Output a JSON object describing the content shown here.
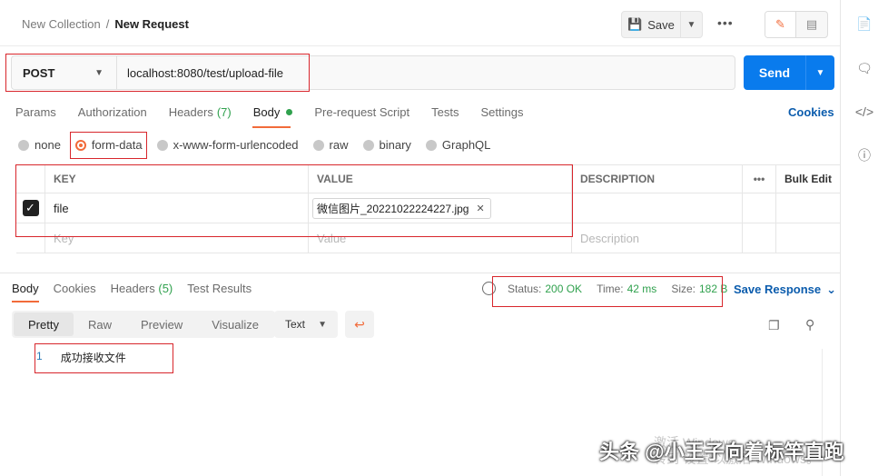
{
  "breadcrumb": {
    "parent": "New Collection",
    "separator": "/",
    "current": "New Request"
  },
  "toolbar": {
    "save_label": "Save",
    "more_label": "•••"
  },
  "request": {
    "method": "POST",
    "url": "localhost:8080/test/upload-file",
    "send_label": "Send"
  },
  "request_tabs": [
    {
      "label": "Params"
    },
    {
      "label": "Authorization"
    },
    {
      "label": "Headers",
      "count": "(7)"
    },
    {
      "label": "Body"
    },
    {
      "label": "Pre-request Script"
    },
    {
      "label": "Tests"
    },
    {
      "label": "Settings"
    }
  ],
  "cookies_label": "Cookies",
  "body_types": [
    "none",
    "form-data",
    "x-www-form-urlencoded",
    "raw",
    "binary",
    "GraphQL"
  ],
  "body_type_selected": "form-data",
  "kv_table": {
    "headers": {
      "key": "KEY",
      "value": "VALUE",
      "description": "DESCRIPTION",
      "more": "•••",
      "bulk": "Bulk Edit"
    },
    "rows": [
      {
        "key": "file",
        "value": "微信图片_20221022224227.jpg",
        "checked": true
      }
    ],
    "placeholder": {
      "key": "Key",
      "value": "Value",
      "description": "Description"
    }
  },
  "response_tabs": [
    {
      "label": "Body"
    },
    {
      "label": "Cookies"
    },
    {
      "label": "Headers",
      "count": "(5)"
    },
    {
      "label": "Test Results"
    }
  ],
  "status": {
    "status_label": "Status:",
    "status_value": "200 OK",
    "time_label": "Time:",
    "time_value": "42 ms",
    "size_label": "Size:",
    "size_value": "182 B"
  },
  "save_response_label": "Save Response",
  "view_modes": [
    "Pretty",
    "Raw",
    "Preview",
    "Visualize"
  ],
  "format_label": "Text",
  "response_body": {
    "line_number": "1",
    "text": "成功接收文件"
  },
  "watermark": {
    "line1": "激活 Windows",
    "line2": "转到“设置”以激活 Windows。"
  },
  "brand": "头条 @小王子向着标竿直跑",
  "colors": {
    "accent": "#f26b3a",
    "primary": "#097bed",
    "success": "#30a14e",
    "link": "#0b5cad",
    "annotation": "#d8262c"
  }
}
